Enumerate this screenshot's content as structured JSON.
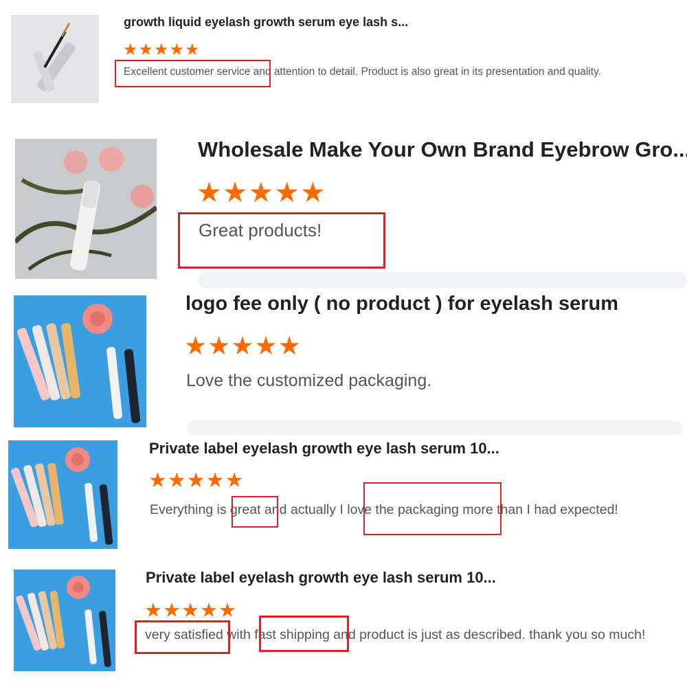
{
  "reviews": [
    {
      "title": "growth liquid eyelash growth serum eye lash s...",
      "stars": "★★★★★",
      "rating": 5,
      "comment": "Excellent customer service and attention to detail. Product is also great in its presentation and quality.",
      "highlights": [
        "Excellent customer service"
      ]
    },
    {
      "title": "Wholesale Make Your Own Brand Eyebrow Gro...",
      "stars": "★★★★★",
      "rating": 5,
      "comment": "Great products!",
      "highlights": [
        "Great products!"
      ]
    },
    {
      "title": "logo fee only ( no product ) for eyelash serum",
      "stars": "★★★★★",
      "rating": 5,
      "comment": "Love the customized packaging.",
      "highlights": []
    },
    {
      "title": "Private label eyelash growth eye lash serum 10...",
      "stars": "★★★★★",
      "rating": 5,
      "comment": "Everything is great and actually I love the packaging more than I had expected!",
      "highlights": [
        "great",
        "I love the packaging"
      ]
    },
    {
      "title": "Private label eyelash growth eye lash serum 10...",
      "stars": "★★★★★",
      "rating": 5,
      "comment": "very satisfied with fast shipping and product is just as described. thank you so much!",
      "highlights": [
        "very satisfied",
        "fast shipping"
      ]
    }
  ],
  "colors": {
    "star": "#ff6a00",
    "highlight_box": "#e02020",
    "title": "#222222",
    "comment": "#555555"
  }
}
